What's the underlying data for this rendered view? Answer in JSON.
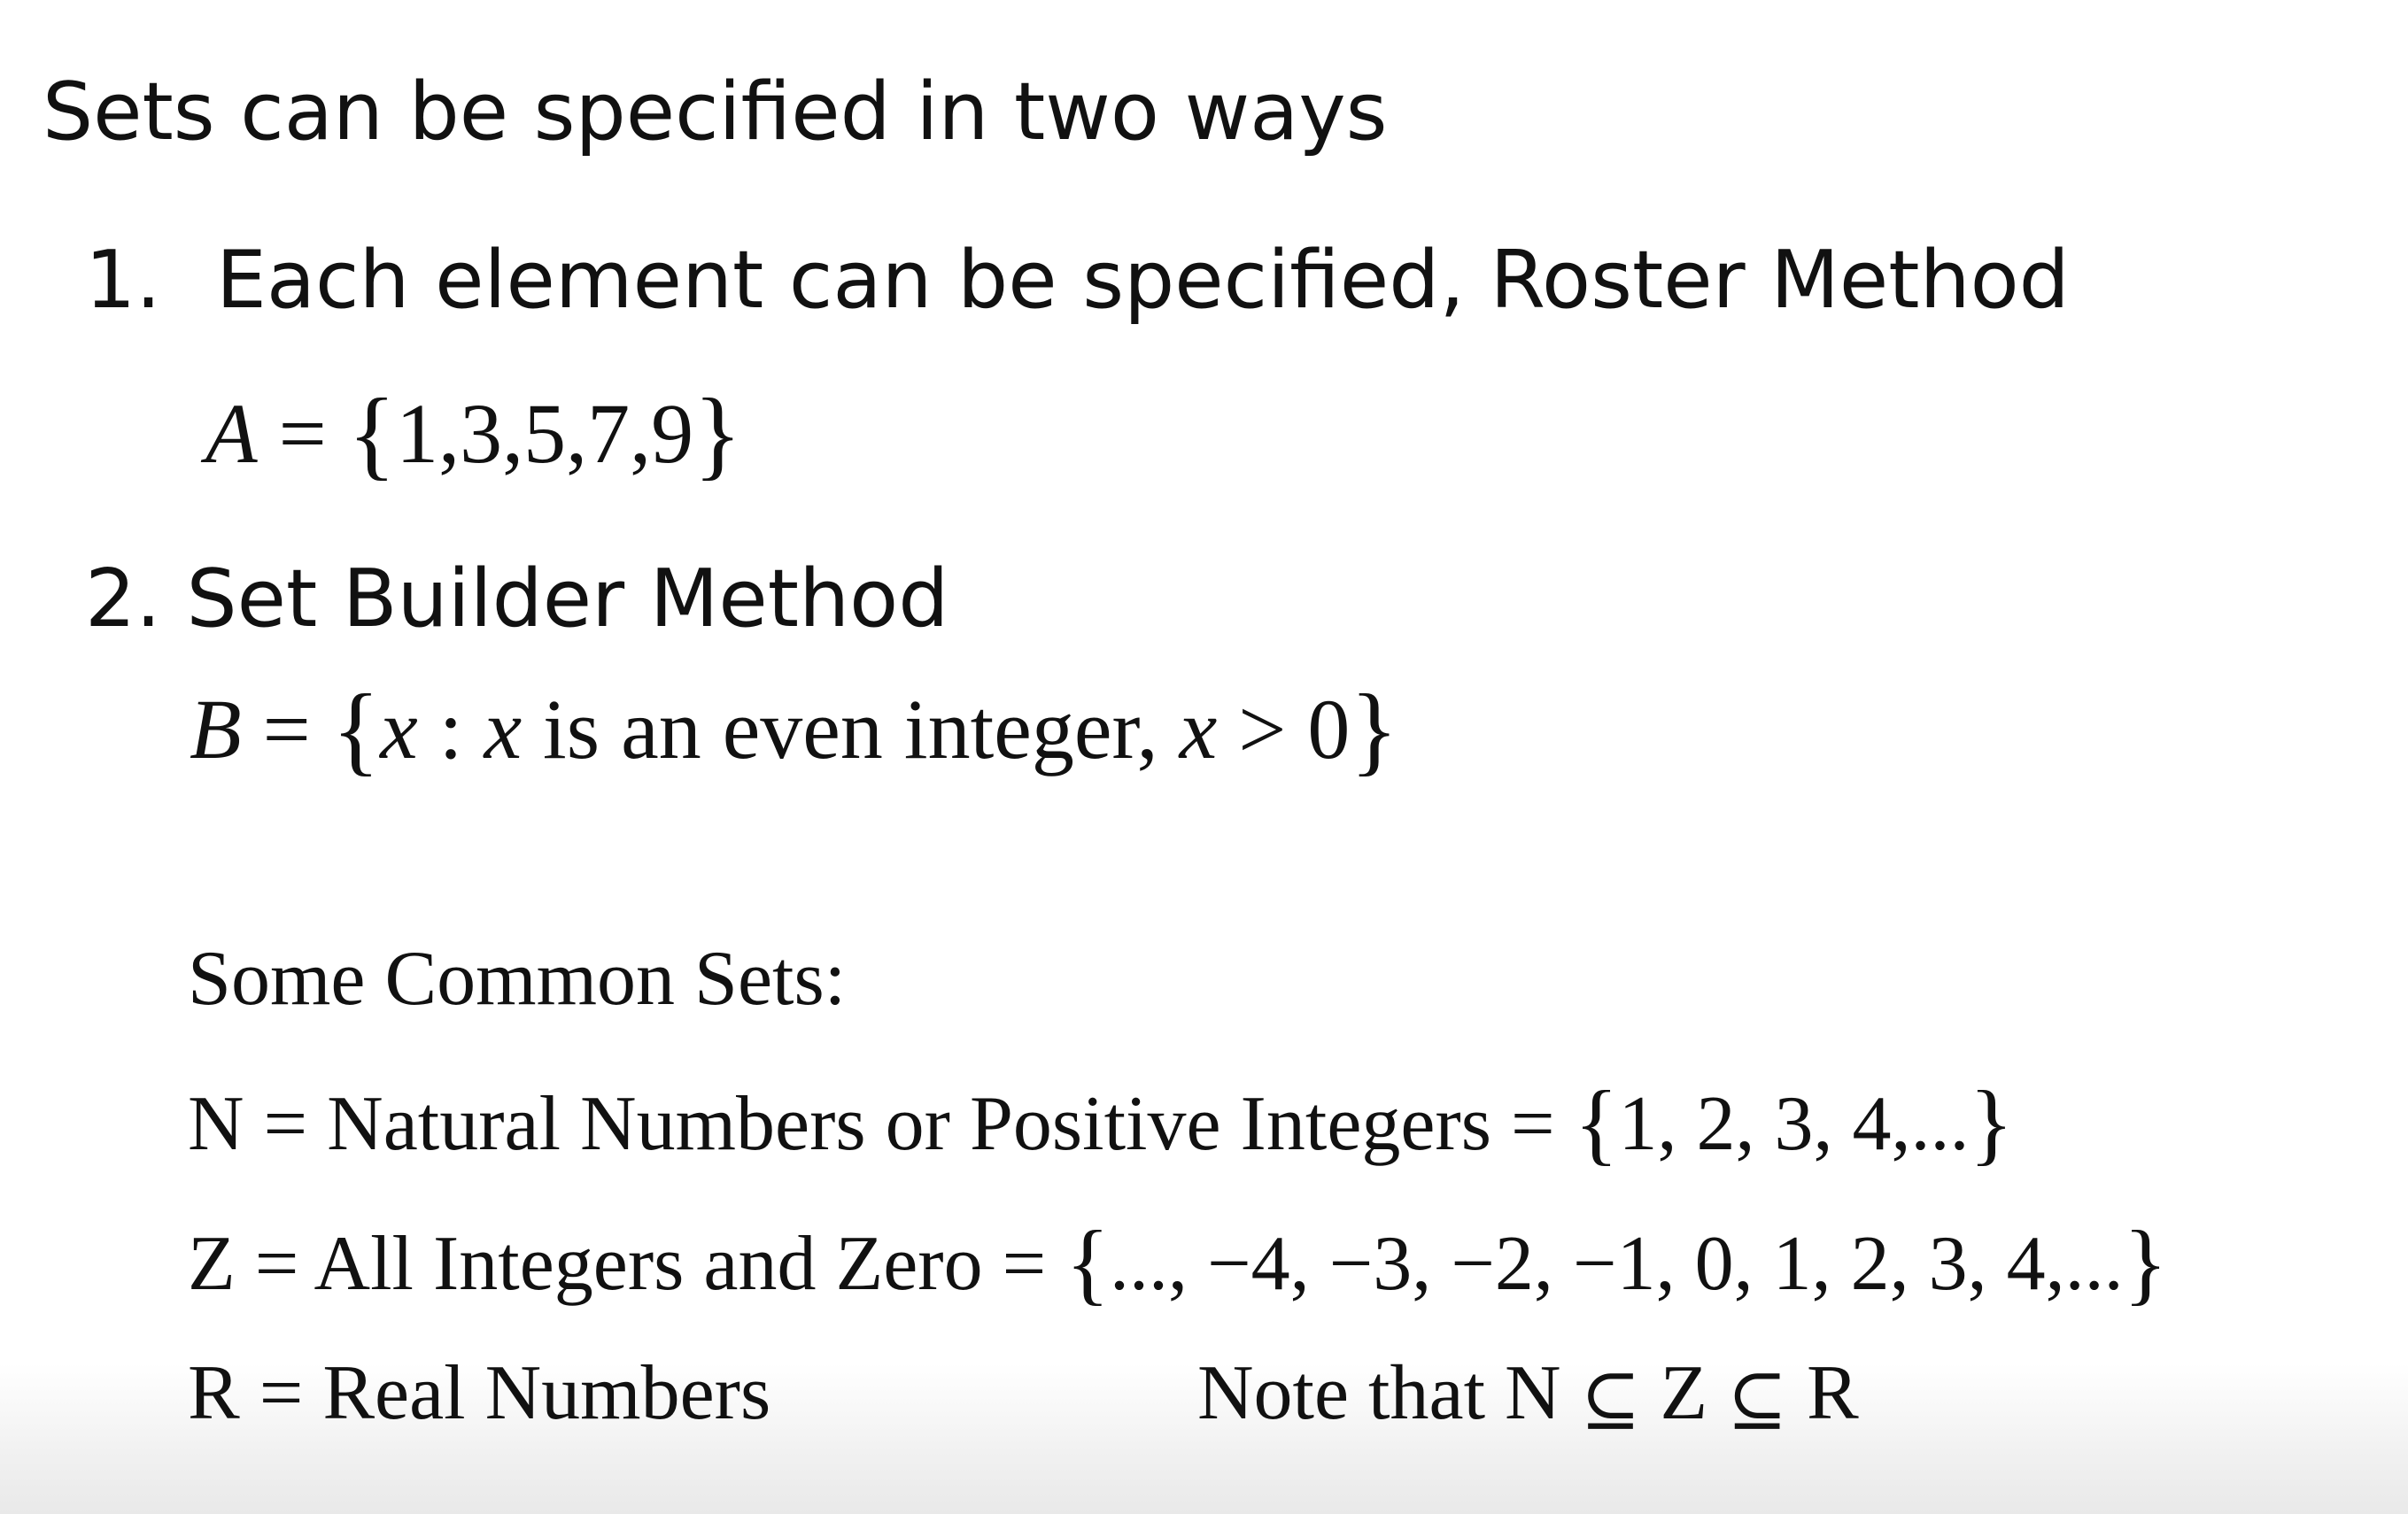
{
  "slide": {
    "title": "Sets can be specified in two ways",
    "item1": {
      "number": "1.",
      "text": "Each element can be specified, Roster Method",
      "math": {
        "var": "A",
        "eq": " = ",
        "open": "{",
        "content": "1,3,5,7,9",
        "close": "}"
      }
    },
    "item2": {
      "text": "2. Set Builder Method",
      "math": {
        "var": "B",
        "eq": " = ",
        "open": "{",
        "x1": "x",
        "colon": " : ",
        "x2": "x",
        "middle": " is an even integer, ",
        "x3": "x",
        "tail": " > 0",
        "close": "}"
      }
    },
    "common_sets": {
      "heading": "Some Common Sets:",
      "natural": {
        "label": "N = Natural Numbers or Positive Integers = ",
        "open": "{",
        "content": "1, 2, 3, 4,...",
        "close": "}"
      },
      "integers": {
        "label": "Z = All Integers and Zero = ",
        "open": "{",
        "content": "..., −4, −3, −2, −1, 0, 1, 2, 3, 4,...",
        "close": "}"
      },
      "real": {
        "label": "R = Real Numbers"
      },
      "note": {
        "prefix": "Note that N ",
        "sub1": "⊆",
        "mid": " Z ",
        "sub2": "⊆",
        "end": " R"
      }
    }
  }
}
